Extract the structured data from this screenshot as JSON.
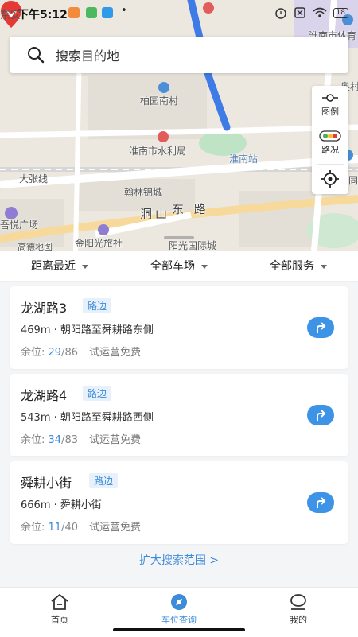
{
  "status_bar": {
    "carrier": "奈安",
    "time": "下午5:12",
    "app_icons": [
      "orange-app-icon",
      "green-app-icon",
      "blue-app-icon"
    ],
    "dot": "•",
    "battery": "18",
    "icons": [
      "alarm-icon",
      "sim-off-icon",
      "wifi-icon",
      "battery-icon"
    ]
  },
  "search": {
    "placeholder": "搜索目的地"
  },
  "map": {
    "labels": {
      "baiyuan": "柏园南村",
      "shuili": "淮南市水利局",
      "huainan_station": "淮南站",
      "hanlin": "翰林锦城",
      "dashang": "洞山",
      "road_east": "东 路",
      "jinyang": "金阳光旅社",
      "wuyue": "吾悦广场",
      "yangguang": "阳光国际城",
      "dazhang": "大张线",
      "stadium": "淮南市体育",
      "kuiyi": "奥村",
      "tong": "同",
      "gaode": "高德地图"
    }
  },
  "tools": {
    "legend_label": "图例",
    "traffic_label": "路况"
  },
  "filters": {
    "distance": "距离最近",
    "lots": "全部车场",
    "services": "全部服务"
  },
  "cards": [
    {
      "name": "龙湖路3",
      "tag": "路边",
      "address": "469m · 朝阳路至舜耕路东侧",
      "avail_label": "余位: ",
      "available": "29",
      "total": "/86",
      "promo": "试运营免费"
    },
    {
      "name": "龙湖路4",
      "tag": "路边",
      "address": "543m · 朝阳路至舜耕路西侧",
      "avail_label": "余位: ",
      "available": "34",
      "total": "/83",
      "promo": "试运营免费"
    },
    {
      "name": "舜耕小街",
      "tag": "路边",
      "address": "666m · 舜耕小街",
      "avail_label": "余位: ",
      "available": "11",
      "total": "/40",
      "promo": "试运营免费"
    }
  ],
  "expand_label": "扩大搜索范围 >",
  "tabs": [
    {
      "label": "首页",
      "icon": "home-icon"
    },
    {
      "label": "车位查询",
      "icon": "compass-icon",
      "active": true
    },
    {
      "label": "我的",
      "icon": "user-icon"
    }
  ],
  "colors": {
    "accent": "#3d8bd9",
    "pin": "#e53935",
    "route": "#3f7be6"
  }
}
